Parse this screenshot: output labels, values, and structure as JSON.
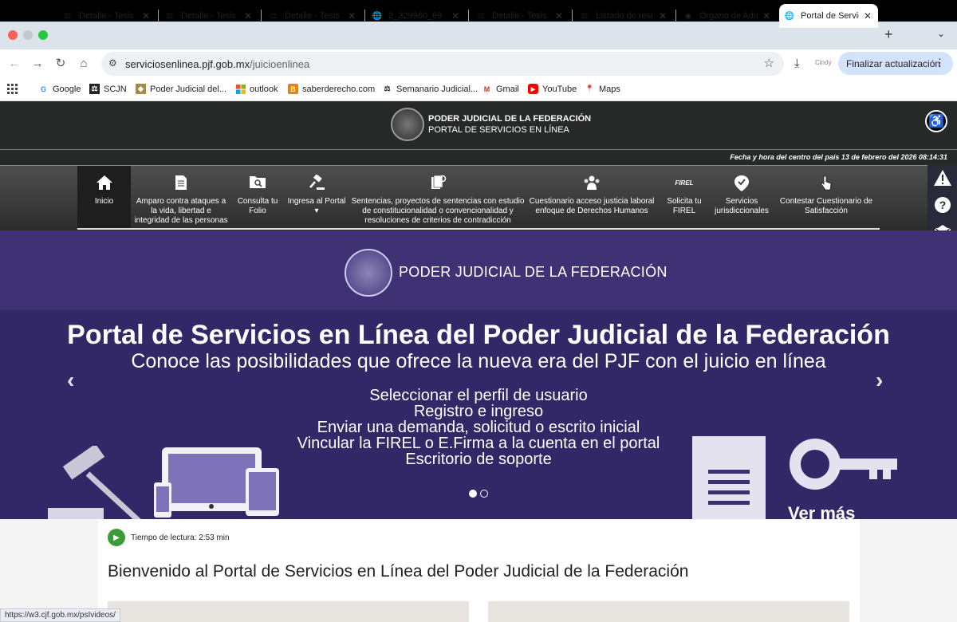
{
  "browser": {
    "tabs": [
      {
        "label": "Detalle - Tesis",
        "icon": "scjn-favicon"
      },
      {
        "label": "Detalle - Tesis",
        "icon": "scjn-favicon"
      },
      {
        "label": "Detalle - Tesis",
        "icon": "scjn-favicon"
      },
      {
        "label": "2_329960_69",
        "icon": "globe-icon"
      },
      {
        "label": "Detalle - Tesis",
        "icon": "scjn-favicon"
      },
      {
        "label": "Listado de resu",
        "icon": "scjn-favicon"
      },
      {
        "label": "Órgano de Adm",
        "icon": "seal-favicon"
      },
      {
        "label": "Portal de Servic",
        "icon": "globe-icon",
        "active": true
      }
    ],
    "close_glyph": "✕",
    "new_tab_glyph": "+",
    "url_domain": "serviciosenlinea.pjf.gob.mx",
    "url_path": "/juicioenlinea",
    "update_button": "Finalizar actualización",
    "profile_text": "Cindy",
    "bookmarks": [
      {
        "label": "Google",
        "icon": "google-icon"
      },
      {
        "label": "SCJN",
        "icon": "scjn-icon"
      },
      {
        "label": "Poder Judicial del...",
        "icon": "pj-icon"
      },
      {
        "label": "outlook",
        "icon": "microsoft-icon"
      },
      {
        "label": "saberderecho.com",
        "icon": "blogger-icon"
      },
      {
        "label": "Semanario Judicial...",
        "icon": "scjn-icon"
      },
      {
        "label": "Gmail",
        "icon": "gmail-icon"
      },
      {
        "label": "YouTube",
        "icon": "youtube-icon"
      },
      {
        "label": "Maps",
        "icon": "maps-icon"
      }
    ],
    "status_url": "https://w3.cjf.gob.mx/psIvideos/"
  },
  "header": {
    "line1": "PODER JUDICIAL DE LA FEDERACIÓN",
    "line2": "PORTAL DE SERVICIOS EN LÍNEA",
    "date_text": "Fecha y hora del centro del país 13 de febrero del 2026 08:14:31"
  },
  "menu": [
    {
      "label": "Inicio",
      "icon": "home-icon",
      "active": true
    },
    {
      "label": "Amparo contra ataques a la vida, libertad e integridad de las personas",
      "icon": "document-icon"
    },
    {
      "label": "Consulta tu Folio",
      "icon": "search-folder-icon"
    },
    {
      "label": "Ingresa al Portal",
      "icon": "gavel-icon",
      "dropdown": true
    },
    {
      "label": "Sentencias, proyectos de sentencias con estudio de constitucionalidad o convencionalidad y resoluciones de criterios de contradicción",
      "icon": "documents-icon"
    },
    {
      "label": "Cuestionario acceso justicia laboral enfoque de Derechos Humanos",
      "icon": "people-icon"
    },
    {
      "label": "Solicita tu FIREL",
      "icon": "firel-icon"
    },
    {
      "label": "Servicios jurisdiccionales",
      "icon": "location-icon"
    },
    {
      "label": "Contestar Cuestionario de Satisfacción",
      "icon": "pointer-icon"
    }
  ],
  "banner": {
    "org_title": "PODER JUDICIAL DE LA FEDERACIÓN",
    "title": "Portal de Servicios en Línea del Poder Judicial de la Federación",
    "subtitle": "Conoce las posibilidades que ofrece la nueva era del PJF con el juicio en línea",
    "lines": [
      "Seleccionar el perfil de usuario",
      "Registro e ingreso",
      "Enviar una demanda, solicitud o escrito inicial",
      "Vincular la FIREL o E.Firma a la cuenta en el portal",
      "Escritorio de soporte"
    ],
    "ver_mas": "Ver más",
    "slide_count": 2,
    "active_slide": 1
  },
  "content": {
    "reading_time": "Tiempo de lectura: 2:53 min",
    "welcome": "Bienvenido al Portal de Servicios en Línea del Poder Judicial de la Federación"
  },
  "colors": {
    "header_bg": "#272828",
    "banner_bg": "#332867",
    "play_green": "#3a9d3a",
    "update_button_bg": "#d3e3fd"
  }
}
